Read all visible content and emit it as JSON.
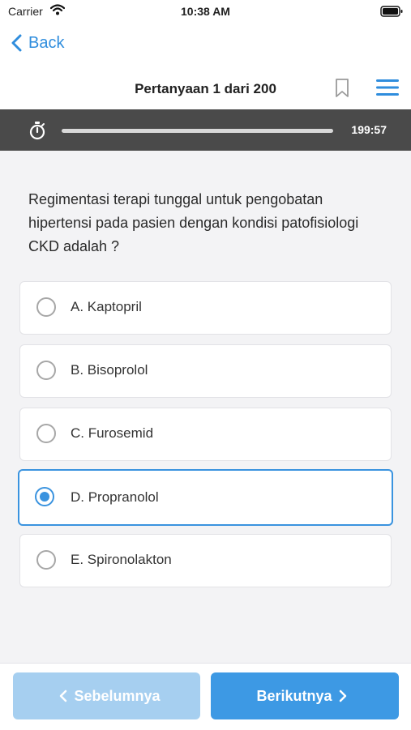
{
  "status_bar": {
    "carrier": "Carrier",
    "time": "10:38 AM"
  },
  "nav": {
    "back_label": "Back",
    "title": "Pertanyaan 1 dari 200"
  },
  "timer": {
    "remaining": "199:57"
  },
  "question": {
    "text": "Regimentasi terapi tunggal untuk pengobatan hipertensi pada pasien dengan kondisi patofisiologi CKD adalah ?"
  },
  "options": [
    {
      "label": "A. Kaptopril",
      "selected": false
    },
    {
      "label": "B. Bisoprolol",
      "selected": false
    },
    {
      "label": "C. Furosemid",
      "selected": false
    },
    {
      "label": "D. Propranolol",
      "selected": true
    },
    {
      "label": "E. Spironolakton",
      "selected": false
    }
  ],
  "footer": {
    "prev_label": "Sebelumnya",
    "next_label": "Berikutnya"
  },
  "colors": {
    "accent": "#3a93df",
    "prev_button": "#a6cff0",
    "next_button": "#3d99e4",
    "timer_bar": "#4a4a4a"
  }
}
